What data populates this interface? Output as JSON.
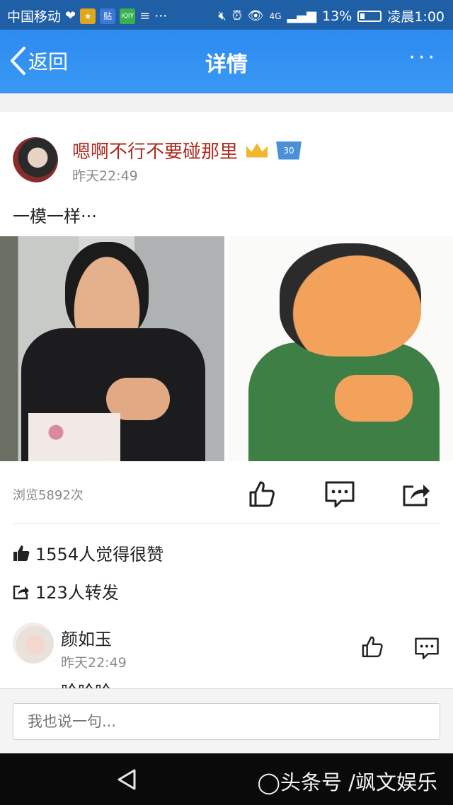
{
  "status_bar": {
    "carrier": "中国移动",
    "badge_tie": "贴",
    "badge_iqiyi": "iQIY",
    "more": "···",
    "network": "4G",
    "battery": "13%",
    "time": "凌晨1:00"
  },
  "nav": {
    "back_label": "返回",
    "title": "详情",
    "more_label": "···"
  },
  "post": {
    "author": "嗯啊不行不要碰那里",
    "level_badge": "30",
    "time": "昨天22:49",
    "text": "一模一样···",
    "views": "浏览5892次",
    "likes": "1554人觉得很赞",
    "shares": "123人转发"
  },
  "comment": {
    "name": "颜如玉",
    "time": "昨天22:49",
    "text": "哈哈哈"
  },
  "input": {
    "placeholder": "我也说一句..."
  },
  "watermark": "◯头条号 /飒文娱乐",
  "colors": {
    "nav_bg": "#3a98f4",
    "status_bg": "#1f5fa6",
    "author_name": "#b02a1e",
    "muted": "#8a8a8a"
  }
}
